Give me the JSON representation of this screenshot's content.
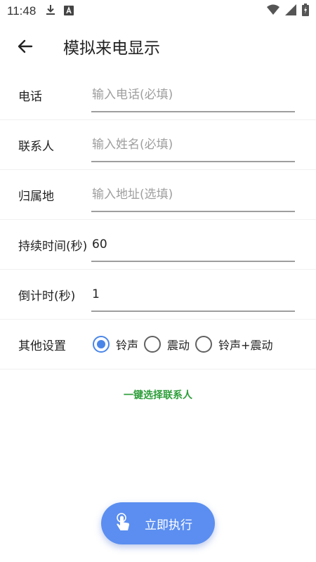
{
  "status_bar": {
    "time": "11:48",
    "icons": [
      "download-icon",
      "a-icon",
      "wifi-icon",
      "battery-charging-icon"
    ]
  },
  "app_bar": {
    "back_icon": "arrow-left-icon",
    "title": "模拟来电显示"
  },
  "form": {
    "phone": {
      "label": "电话",
      "value": "",
      "placeholder": "输入电话(必填)"
    },
    "contact": {
      "label": "联系人",
      "value": "",
      "placeholder": "输入姓名(必填)"
    },
    "location": {
      "label": "归属地",
      "value": "",
      "placeholder": "输入地址(选填)"
    },
    "duration": {
      "label": "持续时间(秒)",
      "value": "60",
      "placeholder": ""
    },
    "countdown": {
      "label": "倒计时(秒)",
      "value": "1",
      "placeholder": ""
    },
    "other": {
      "label": "其他设置",
      "options": [
        {
          "label": "铃声",
          "checked": true
        },
        {
          "label": "震动",
          "checked": false
        },
        {
          "label": "铃声+震动",
          "checked": false
        }
      ]
    }
  },
  "select_contact_label": "一键选择联系人",
  "fab": {
    "label": "立即执行",
    "icon": "touch-icon"
  },
  "colors": {
    "accent": "#4a86e8",
    "fab": "#5b8ef0",
    "link_green": "#2e9e3a"
  }
}
